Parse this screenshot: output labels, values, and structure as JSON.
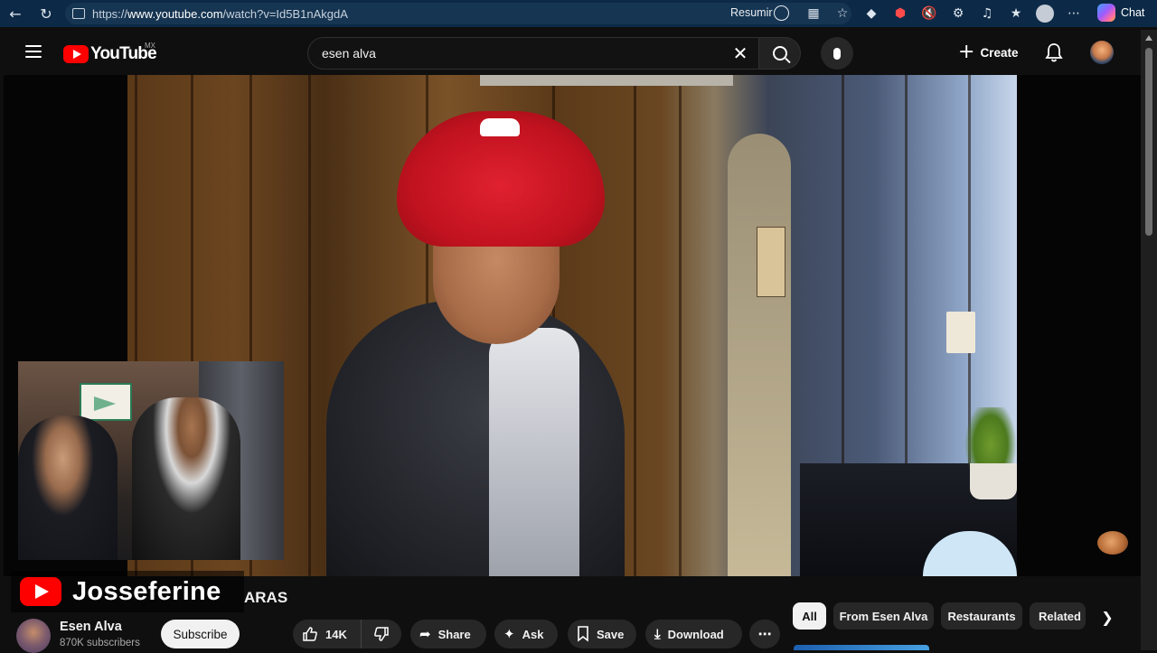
{
  "browser": {
    "url_prefix": "https://",
    "url_host": "www.youtube.com",
    "url_path": "/watch?v=Id5B1nAkgdA",
    "resumir_label": "Resumir",
    "chat_label": "Chat",
    "icons": [
      "back-icon",
      "refresh-icon",
      "lock-icon",
      "resumir-icon",
      "split-screen-icon",
      "favorite-star-icon",
      "extension-icon",
      "extension-red-icon",
      "mute-icon",
      "puzzle-icon",
      "collections-icon",
      "favorites-icon",
      "profile-icon",
      "more-icon",
      "copilot-icon"
    ]
  },
  "masthead": {
    "logo_text": "YouTube",
    "region": "MX",
    "search_value": "esen alva",
    "create_label": "Create"
  },
  "video": {
    "watermark_text": "Josseferine",
    "title_fragment": "ARAS"
  },
  "channel": {
    "name": "Esen Alva",
    "subscribers": "870K subscribers",
    "subscribe_label": "Subscribe"
  },
  "actions": {
    "like_count": "14K",
    "share": "Share",
    "ask": "Ask",
    "save": "Save",
    "download": "Download"
  },
  "chips": [
    "All",
    "From Esen Alva",
    "Restaurants",
    "Related"
  ],
  "colors": {
    "browser_bar": "#0c2a47",
    "youtube_red": "#ff0000",
    "page_bg": "#0f0f0f"
  }
}
